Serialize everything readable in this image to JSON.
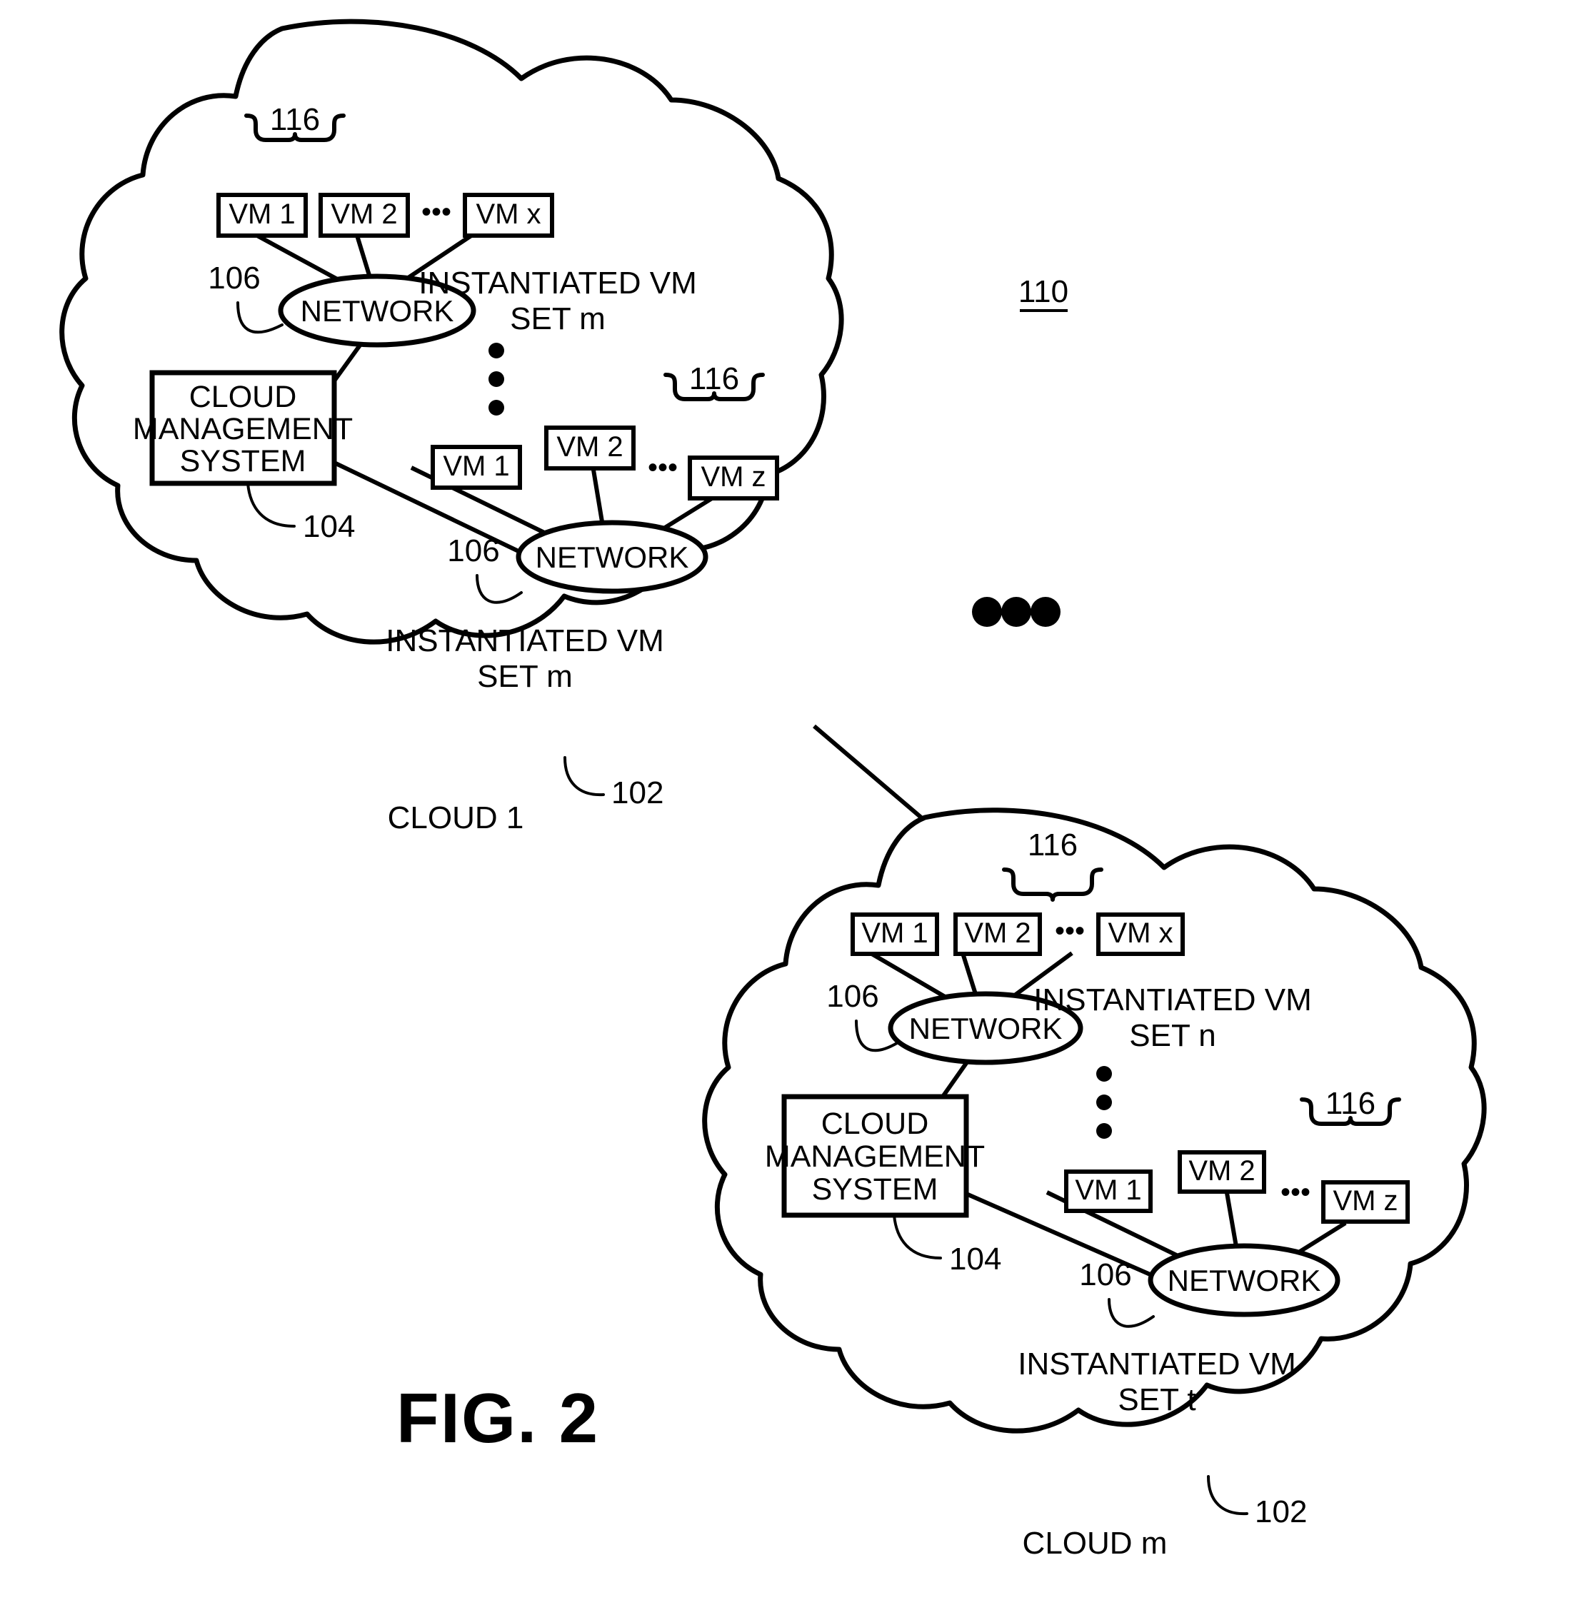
{
  "figure": {
    "caption": "FIG. 2",
    "system_ref": "110"
  },
  "clouds": [
    {
      "id": "cloud-1",
      "name": "CLOUD 1",
      "ref": "102",
      "management_system": {
        "label_line1": "CLOUD",
        "label_line2": "MANAGEMENT",
        "label_line3": "SYSTEM",
        "ref": "104"
      },
      "vm_sets": [
        {
          "id": "set-m-top",
          "label_line1": "INSTANTIATED VM",
          "label_line2": "SET m",
          "brace_ref": "116",
          "network_label": "NETWORK",
          "network_ref": "106",
          "vms": [
            "VM 1",
            "VM 2",
            "VM x"
          ],
          "ellipsis": "•••"
        },
        {
          "id": "set-m-bottom",
          "label_line1": "INSTANTIATED VM",
          "label_line2": "SET m",
          "brace_ref": "116",
          "network_label": "NETWORK",
          "network_ref": "106",
          "vms": [
            "VM 1",
            "VM 2",
            "VM z"
          ],
          "ellipsis": "•••"
        }
      ],
      "vertical_ellipsis": "⋮"
    },
    {
      "id": "cloud-m",
      "name": "CLOUD m",
      "ref": "102",
      "management_system": {
        "label_line1": "CLOUD",
        "label_line2": "MANAGEMENT",
        "label_line3": "SYSTEM",
        "ref": "104"
      },
      "vm_sets": [
        {
          "id": "set-n-top",
          "label_line1": "INSTANTIATED VM",
          "label_line2": "SET n",
          "brace_ref": "116",
          "network_label": "NETWORK",
          "network_ref": "106",
          "vms": [
            "VM 1",
            "VM 2",
            "VM x"
          ],
          "ellipsis": "•••"
        },
        {
          "id": "set-t-bottom",
          "label_line1": "INSTANTIATED VM",
          "label_line2": "SET t",
          "brace_ref": "116",
          "network_label": "NETWORK",
          "network_ref": "106",
          "vms": [
            "VM 1",
            "VM 2",
            "VM z"
          ],
          "ellipsis": "•••"
        }
      ],
      "vertical_ellipsis": "⋮"
    }
  ],
  "between_clouds_ellipsis": "•••",
  "colors": {
    "ink": "#000000",
    "paper": "#ffffff"
  }
}
